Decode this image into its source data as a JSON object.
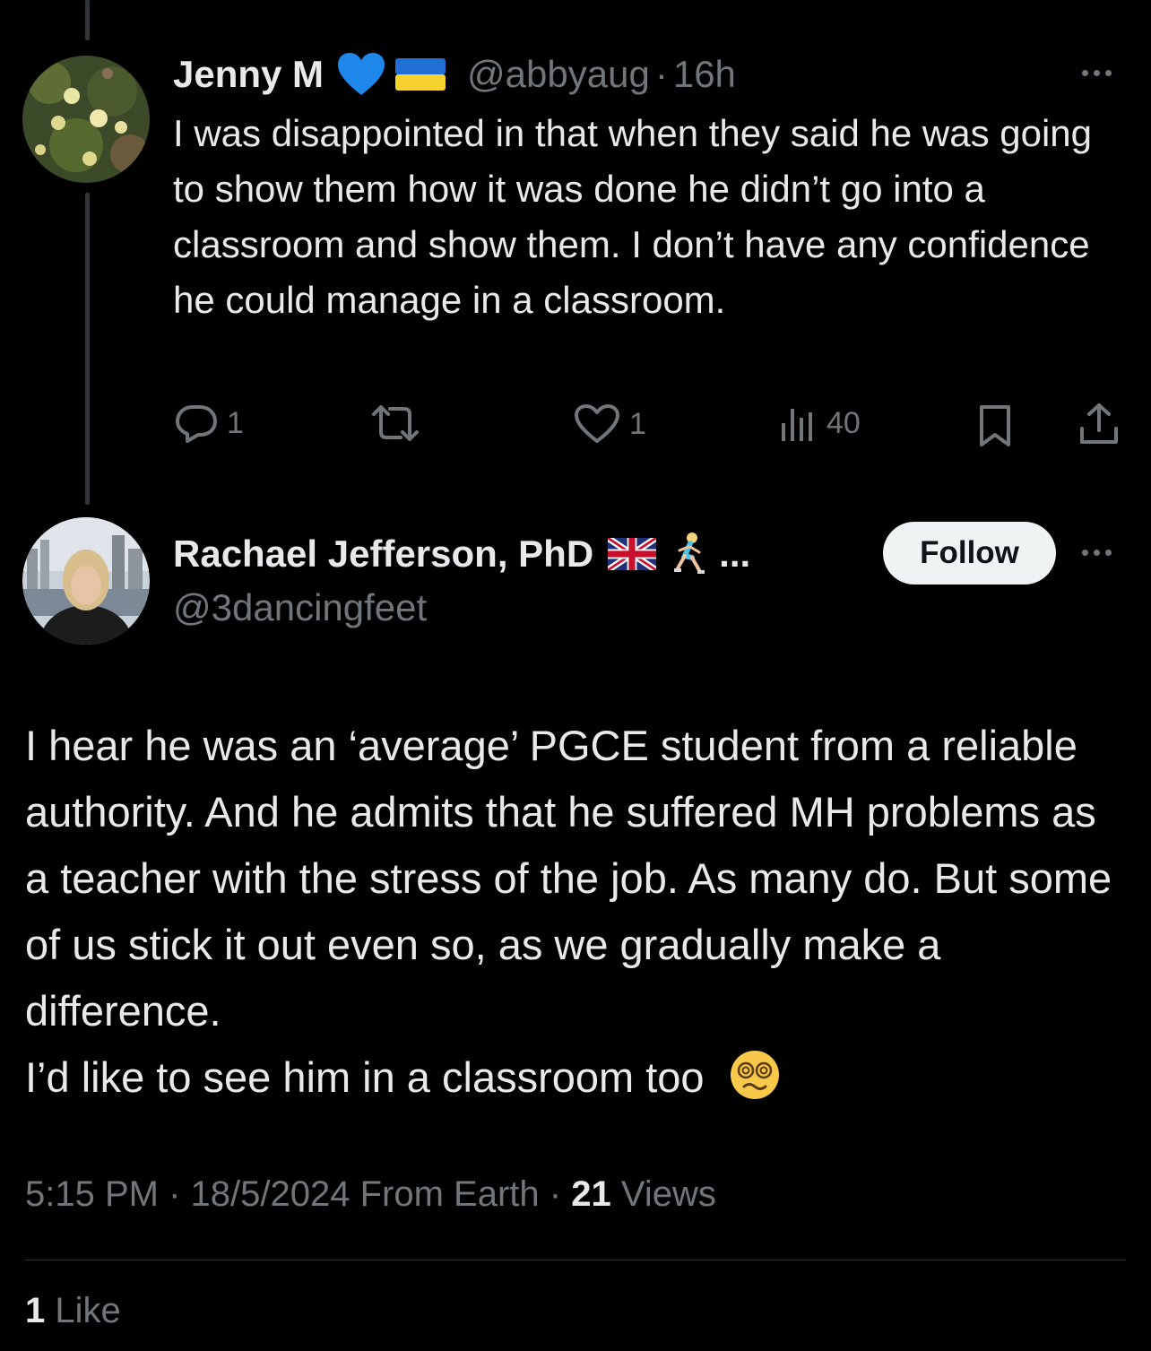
{
  "reply_tweet": {
    "author_name": "Jenny M",
    "name_emojis": [
      "blue-heart-icon",
      "ukraine-flag-icon"
    ],
    "handle": "@abbyaug",
    "separator": "·",
    "time": "16h",
    "text": "I was disappointed in that when they said he was going to show them how it was done he didn’t go into a classroom and show them. I don’t have any confidence he could manage in a classroom.",
    "actions": {
      "reply_count": "1",
      "retweet_count": "",
      "like_count": "1",
      "views_count": "40"
    }
  },
  "main_tweet": {
    "author_name": "Rachael Jefferson, PhD",
    "name_emojis": [
      "uk-flag-icon",
      "woman-running-icon"
    ],
    "name_ellipsis": "...",
    "handle": "@3dancingfeet",
    "follow_label": "Follow",
    "text_lines": [
      "I hear he was an ‘average’ PGCE student from a reliable authority. And he admits that he suffered MH problems as a teacher with the stress of the job. As many do. But some of us stick it out even so, as we gradually make a difference.",
      "I’d like to see him in a classroom too"
    ],
    "trailing_emoji": "face-with-spiral-eyes-icon",
    "meta": {
      "time": "5:15 PM",
      "separator": "·",
      "date": "18/5/2024",
      "source": "From Earth",
      "views_count": "21",
      "views_label": "Views"
    },
    "likes": {
      "count": "1",
      "label": "Like"
    }
  },
  "colors": {
    "background": "#000000",
    "text": "#e7e9ea",
    "muted": "#71767b",
    "follow_bg": "#eff3f4"
  }
}
